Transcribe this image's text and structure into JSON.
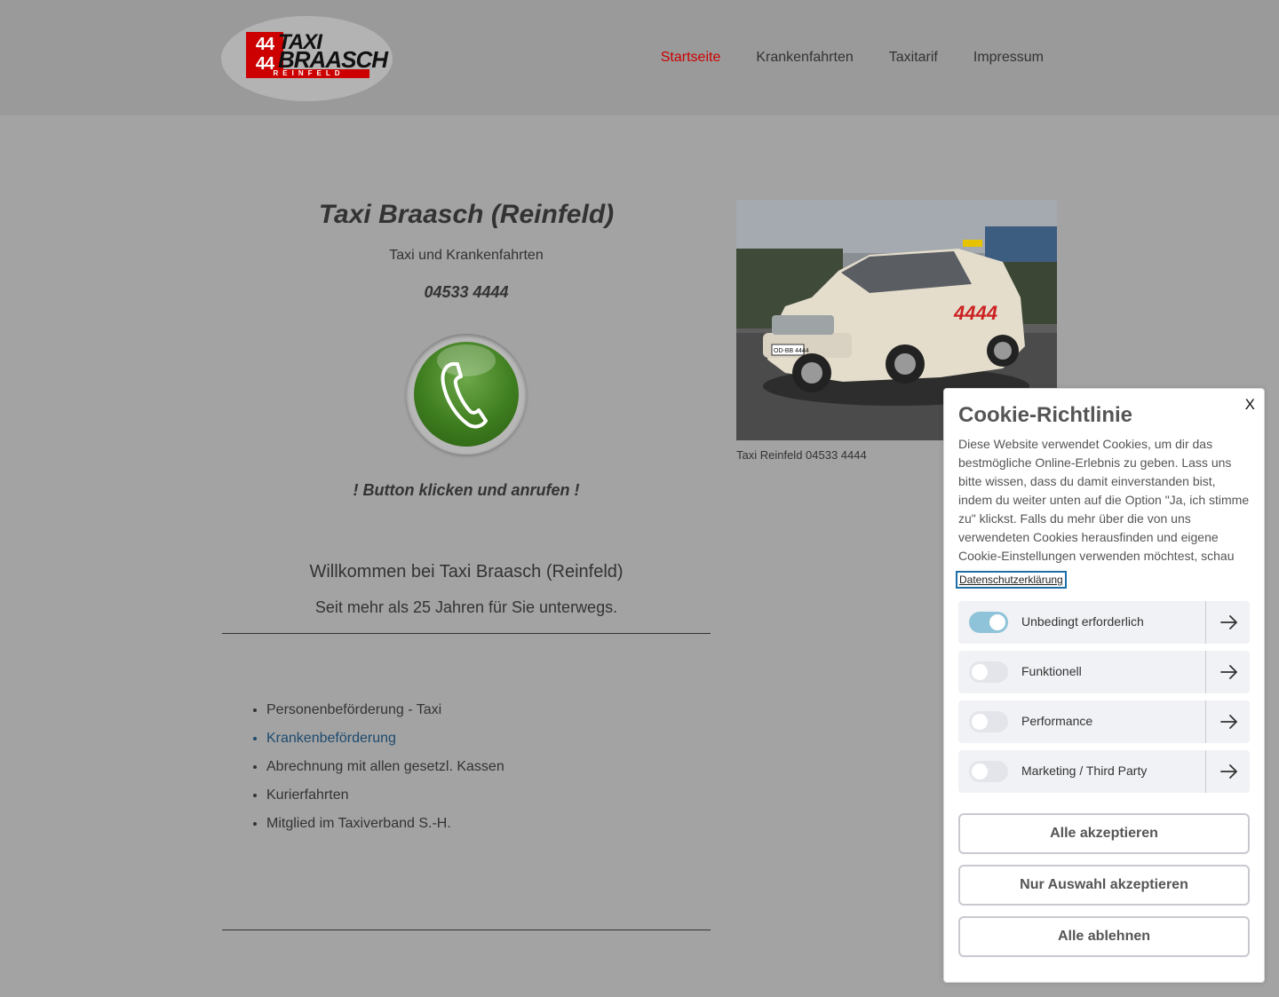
{
  "logo": {
    "num_top": "44",
    "num_bottom": "44",
    "word_top": "TAXI",
    "word_bottom": "BRAASCH",
    "sub": "REINFELD"
  },
  "nav": {
    "items": [
      {
        "label": "Startseite",
        "active": true
      },
      {
        "label": "Krankenfahrten"
      },
      {
        "label": "Taxitarif"
      },
      {
        "label": "Impressum"
      }
    ]
  },
  "main": {
    "title": "Taxi Braasch (Reinfeld)",
    "subtitle": "Taxi und Krankenfahrten",
    "phone": "04533 4444",
    "cta": "! Button klicken und anrufen !",
    "welcome": "Willkommen bei Taxi Braasch (Reinfeld)",
    "since": "Seit mehr als 25 Jahren für Sie unterwegs.",
    "services": [
      "Personenbeförderung - Taxi",
      "Krankenbeförderung",
      "Abrechnung mit allen gesetzl. Kassen",
      "Kurierfahrten",
      "Mitglied im Taxiverband S.-H."
    ],
    "image_caption": "Taxi Reinfeld 04533 4444",
    "car_plate": "OD-BB 4444",
    "car_number": "4444"
  },
  "cookie": {
    "close": "X",
    "title": "Cookie-Richtlinie",
    "text": "Diese Website verwendet Cookies, um dir das bestmögliche Online-Erlebnis zu geben. Lass uns bitte wissen, dass du damit einverstanden bist, indem du weiter unten auf die Option \"Ja, ich stimme zu\" klickst. Falls du mehr über die von uns verwendeten Cookies herausfinden und eigene Cookie-Einstellungen verwenden möchtest, schau",
    "link": "Datenschutzerklärung",
    "categories": [
      {
        "label": "Unbedingt erforderlich",
        "enabled": true
      },
      {
        "label": "Funktionell",
        "enabled": false
      },
      {
        "label": "Performance",
        "enabled": false
      },
      {
        "label": "Marketing / Third Party",
        "enabled": false
      }
    ],
    "buttons": {
      "accept_all": "Alle akzeptieren",
      "accept_selection": "Nur Auswahl akzeptieren",
      "reject_all": "Alle ablehnen"
    }
  },
  "colors": {
    "nav_active": "#cc0000",
    "toggle_on": "#8fc3d9",
    "link": "#1d4a6e"
  }
}
